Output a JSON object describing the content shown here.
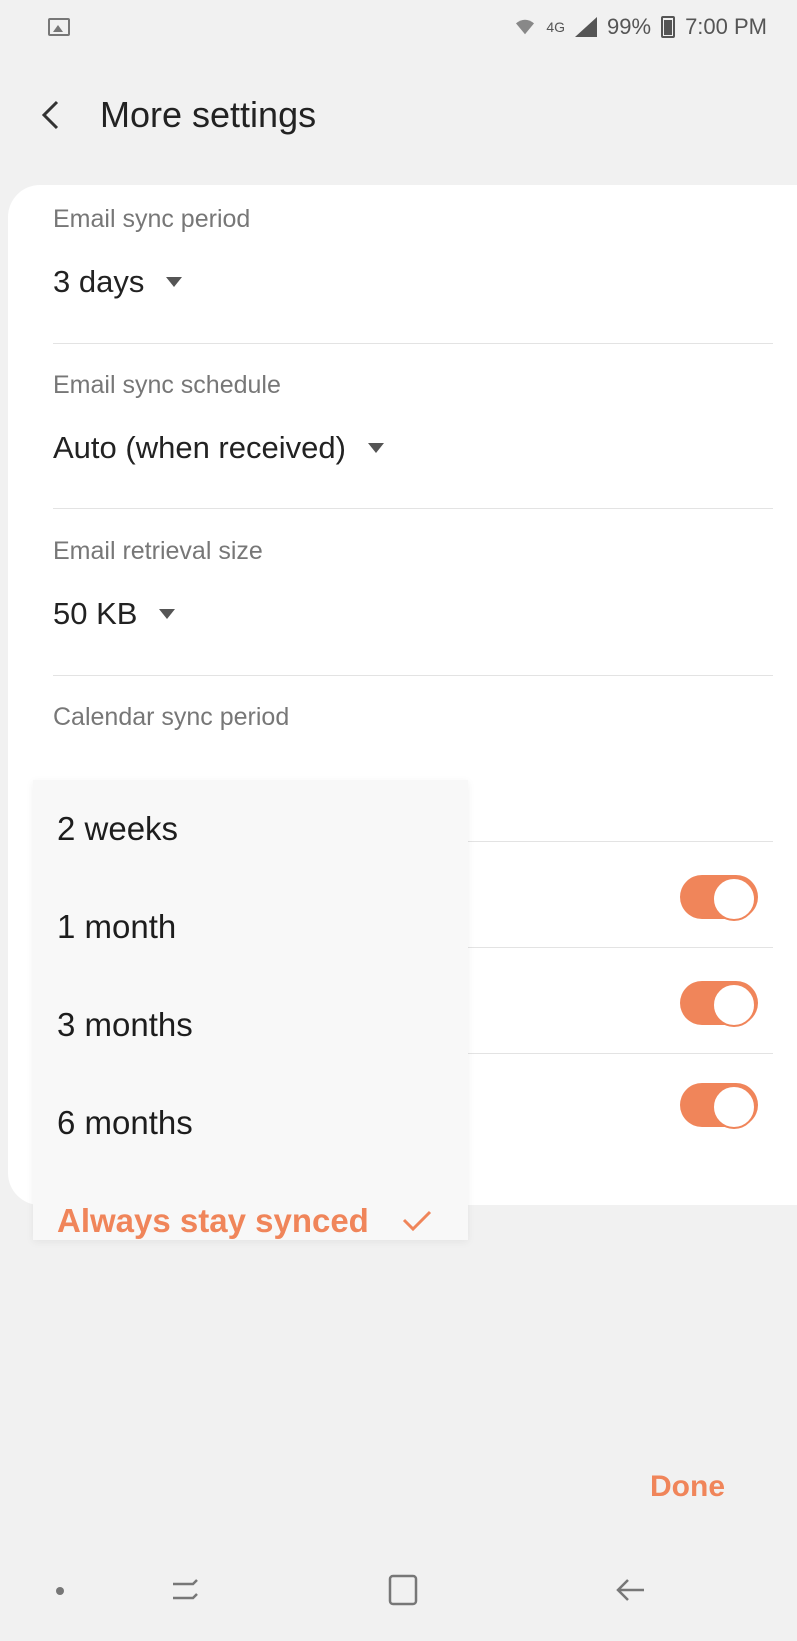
{
  "status_bar": {
    "network": "4G",
    "battery": "99%",
    "time": "7:00 PM"
  },
  "header": {
    "title": "More settings"
  },
  "settings": {
    "email_sync_period": {
      "label": "Email sync period",
      "value": "3 days"
    },
    "email_sync_schedule": {
      "label": "Email sync schedule",
      "value": "Auto (when received)"
    },
    "email_retrieval_size": {
      "label": "Email retrieval size",
      "value": "50 KB"
    },
    "calendar_sync_period": {
      "label": "Calendar sync period"
    }
  },
  "dropdown": {
    "options": [
      "2 weeks",
      "1 month",
      "3 months",
      "6 months"
    ],
    "selected": "Always stay synced"
  },
  "toggles": [
    true,
    true,
    true
  ],
  "footer": {
    "done_label": "Done"
  },
  "colors": {
    "accent": "#f0855a",
    "background": "#f1f1f1",
    "card": "#ffffff"
  }
}
